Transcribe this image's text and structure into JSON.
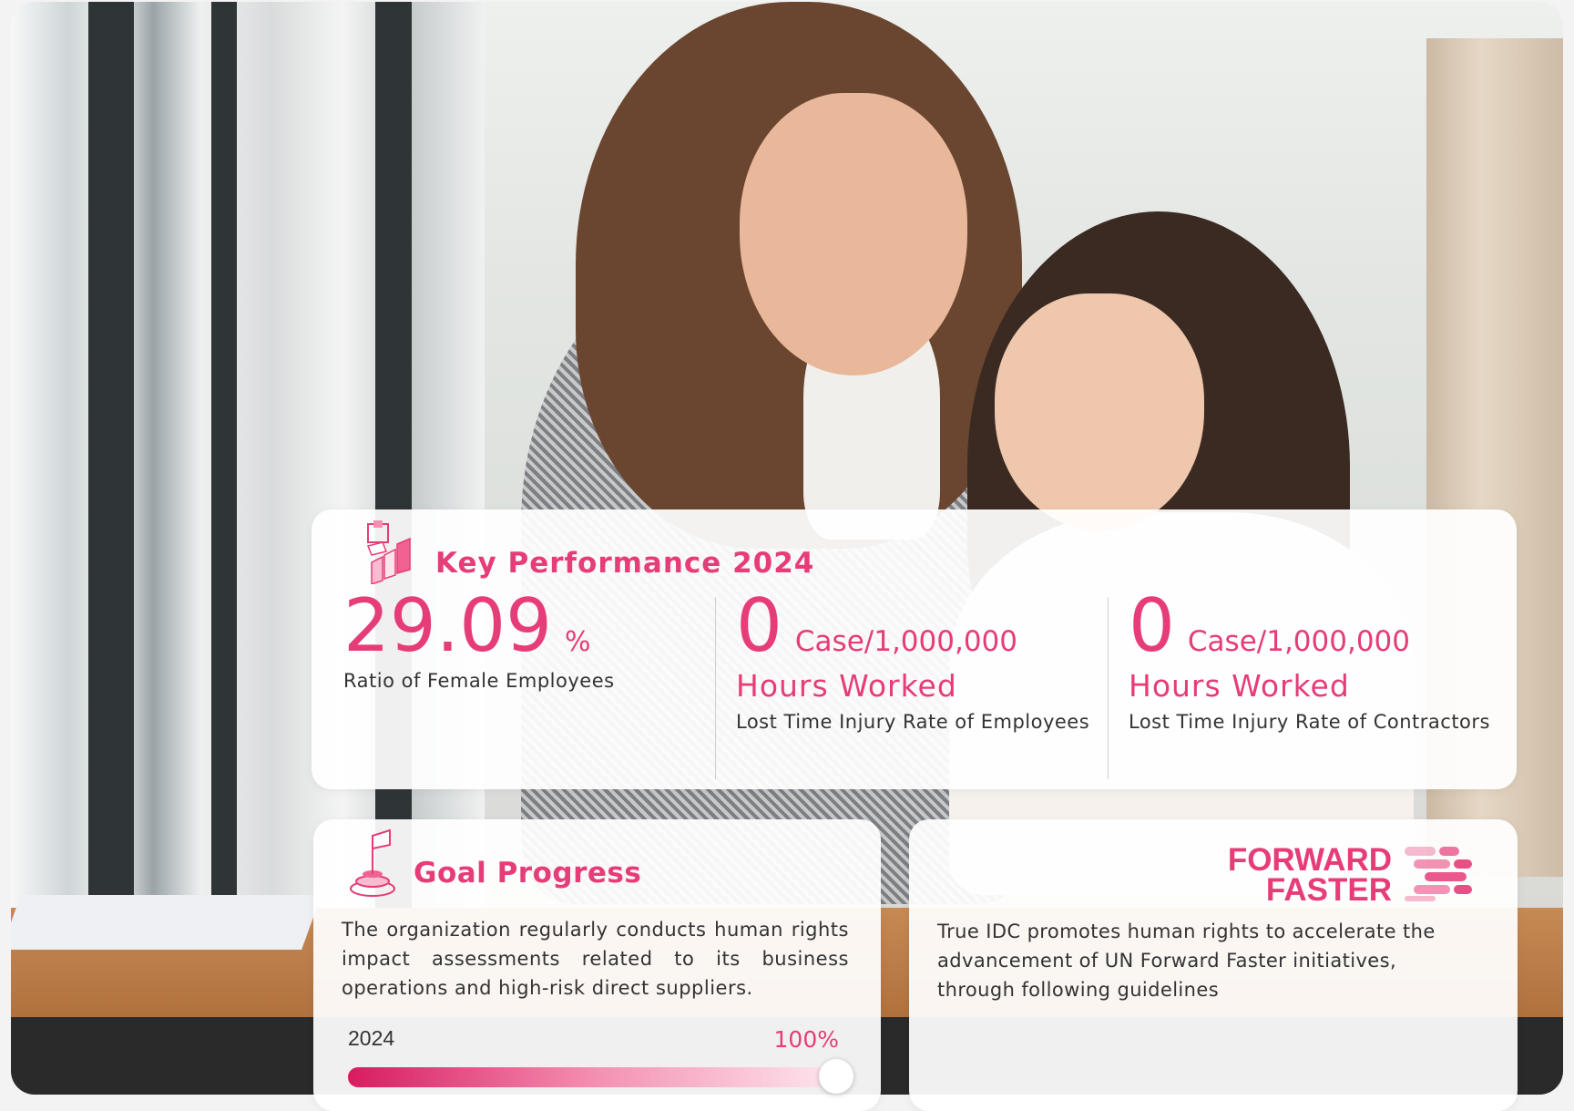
{
  "kpi": {
    "title": "Key Performance 2024",
    "metrics": [
      {
        "value": "29.09",
        "unit": "%",
        "unit_line2": "",
        "caption": "Ratio of Female Employees"
      },
      {
        "value": "0",
        "unit": "Case/1,000,000",
        "unit_line2": "Hours Worked",
        "caption": "Lost Time Injury Rate of Employees"
      },
      {
        "value": "0",
        "unit": "Case/1,000,000",
        "unit_line2": "Hours Worked",
        "caption": "Lost Time Injury Rate of Contractors"
      }
    ]
  },
  "goal": {
    "title": "Goal Progress",
    "text": "The organization regularly conducts human rights impact assessments related to its business operations and high-risk direct suppliers.",
    "year": "2024",
    "progress_label": "100%",
    "progress": 1.0
  },
  "forward_faster": {
    "logo_line1": "FORWARD",
    "logo_line2": "FASTER",
    "text": "True IDC promotes human rights to accelerate the advancement of UN Forward Faster initiatives, through following guidelines"
  },
  "colors": {
    "accent": "#e63c78"
  },
  "icons": {
    "kpi": "chart-blocks-icon",
    "goal": "flag-target-icon",
    "ff": "forward-arrows-icon"
  }
}
